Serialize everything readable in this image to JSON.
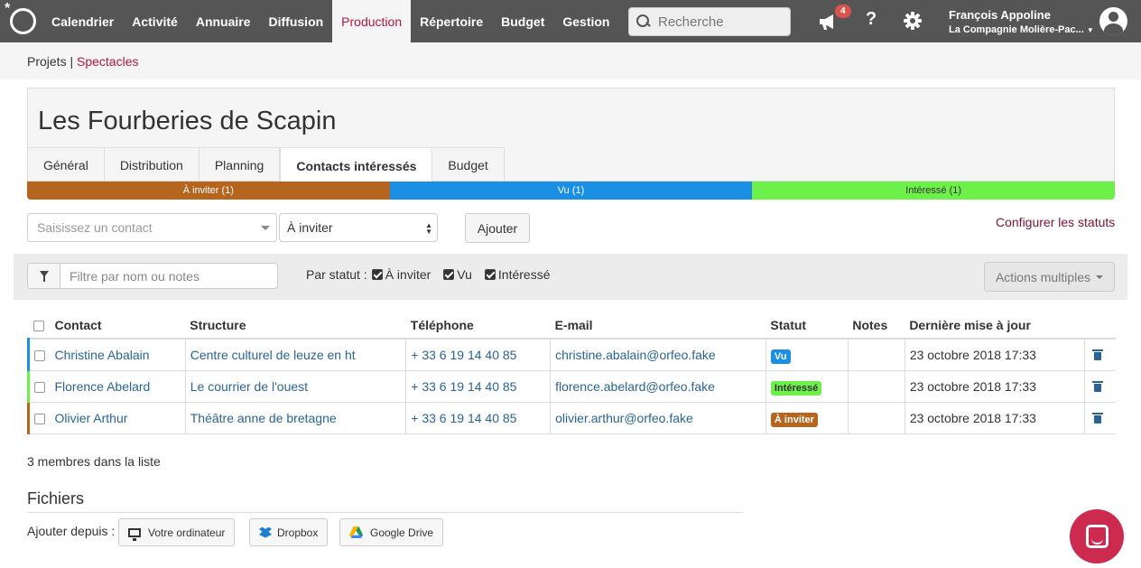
{
  "nav": {
    "items": [
      "Calendrier",
      "Activité",
      "Annuaire",
      "Diffusion",
      "Production",
      "Répertoire",
      "Budget",
      "Gestion"
    ],
    "active_item": "Production",
    "search_placeholder": "Recherche",
    "notification_count": "4",
    "help_icon": "?",
    "user_name": "François Appoline",
    "user_org": "La Compagnie Molière-Pac..."
  },
  "breadcrumb": {
    "parent": "Projets",
    "separator": "|",
    "current": "Spectacles"
  },
  "page": {
    "title": "Les Fourberies de Scapin",
    "tabs": [
      "Général",
      "Distribution",
      "Planning",
      "Contacts intéressés",
      "Budget"
    ],
    "active_tab": "Contacts intéressés"
  },
  "status_bar": [
    {
      "label": "À inviter (1)",
      "color": "#b5651d"
    },
    {
      "label": "Vu (1)",
      "color": "#1a8fe3"
    },
    {
      "label": "Intéressé (1)",
      "color": "#6ef04a"
    }
  ],
  "add_row": {
    "contact_placeholder": "Saisissez un contact",
    "status_value": "À inviter",
    "add_button": "Ajouter",
    "config_link": "Configurer les statuts"
  },
  "filter": {
    "placeholder": "Filtre par nom ou notes",
    "by_status_label": "Par statut :",
    "statuses": [
      "À inviter",
      "Vu",
      "Intéressé"
    ],
    "actions_button": "Actions multiples"
  },
  "table": {
    "columns": [
      "Contact",
      "Structure",
      "Téléphone",
      "E-mail",
      "Statut",
      "Notes",
      "Dernière mise à jour"
    ],
    "rows": [
      {
        "contact": "Christine Abalain",
        "structure": "Centre culturel de leuze en ht",
        "phone": "+ 33 6 19 14 40 85",
        "email": "christine.abalain@orfeo.fake",
        "status": "Vu",
        "status_color": "#1a8fe3",
        "notes": "",
        "updated": "23 octobre 2018 17:33"
      },
      {
        "contact": "Florence Abelard",
        "structure": "Le courrier de l'ouest",
        "phone": "+ 33 6 19 14 40 85",
        "email": "florence.abelard@orfeo.fake",
        "status": "Intéressé",
        "status_color": "#6ef04a",
        "notes": "",
        "updated": "23 octobre 2018 17:33"
      },
      {
        "contact": "Olivier Arthur",
        "structure": "Théâtre anne de bretagne",
        "phone": "+ 33 6 19 14 40 85",
        "email": "olivier.arthur@orfeo.fake",
        "status": "À inviter",
        "status_color": "#b5651d",
        "notes": "",
        "updated": "23 octobre 2018 17:33"
      }
    ]
  },
  "members_count_text": "3 membres dans la liste",
  "files": {
    "title": "Fichiers",
    "add_from_label": "Ajouter depuis :",
    "sources": [
      "Votre ordinateur",
      "Dropbox",
      "Google Drive"
    ]
  }
}
